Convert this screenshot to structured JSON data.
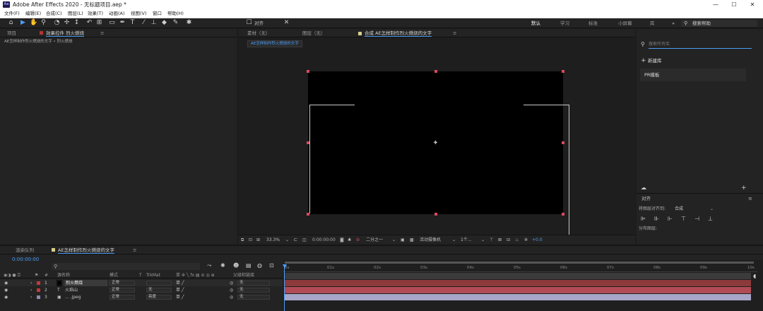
{
  "app": {
    "title": "Adobe After Effects 2020 - 无标题项目.aep *",
    "logo": "Ae",
    "window_controls": [
      "—",
      "☐",
      "✕"
    ]
  },
  "menu": [
    "文件(F)",
    "编辑(E)",
    "合成(C)",
    "图层(L)",
    "效果(T)",
    "动画(A)",
    "视图(V)",
    "窗口",
    "帮助(H)"
  ],
  "toolbar": {
    "align_label": "对齐",
    "workspaces": [
      "默认",
      "学习",
      "标准",
      "小屏幕",
      "库"
    ],
    "active_workspace": "默认",
    "overflow": "»",
    "help_search_placeholder": "搜索帮助"
  },
  "left_panel": {
    "tabs": [
      "项目",
      "效果控件 烈火燃烧"
    ],
    "breadcrumb": "AE怎样制作烈火燃烧的文字 • 烈火燃烧"
  },
  "comp_panel": {
    "tabs": [
      "素材（无）",
      "图层（无）",
      "合成 AE怎样制作烈火燃烧的文字"
    ],
    "comp_chip": "AE怎样制作烈火燃烧的文字"
  },
  "comp_footer": {
    "zoom": "33.3%",
    "timecode": "0:00:00:00",
    "resolution": "二分之一",
    "camera": "活动摄像机",
    "views": "1个...",
    "exposure": "+0.0"
  },
  "right_panel": {
    "search_placeholder": "搜索所有库",
    "new_library": "新建库",
    "library_item": "PR模板",
    "align_title": "对齐",
    "align_to_label": "将图层对齐到:",
    "align_to_value": "合成",
    "distribute_label": "分布图层:"
  },
  "timeline": {
    "tabs": [
      "渲染队列",
      "AE怎样制作烈火燃烧的文字"
    ],
    "timecode": "0:00:00:00",
    "search_placeholder": "",
    "columns": {
      "num": "#",
      "name": "源名称",
      "mode": "模式",
      "t": "T",
      "trkmat": "TrkMat",
      "switches": "单 ✲ ╲ fx ▤ ⊘ ◎ ⊕",
      "parent": "父级和链接"
    },
    "ruler": [
      "0s",
      "01s",
      "02s",
      "03s",
      "04s",
      "05s",
      "06s",
      "07s",
      "08s",
      "09s",
      "10s"
    ],
    "layers": [
      {
        "num": "1",
        "type_icon": "■",
        "name": "烈火燃烧",
        "mode": "正常",
        "trkmat": "",
        "parent": "无",
        "color": "#c23a3a",
        "bar_color": "#8d3a3c"
      },
      {
        "num": "2",
        "type_icon": "T",
        "name": "火焰山",
        "mode": "正常",
        "trkmat": "无",
        "parent": "无",
        "color": "#c23a3a",
        "bar_color": "#b24b55"
      },
      {
        "num": "3",
        "type_icon": "▣",
        "name": "... .jpeg",
        "mode": "正常",
        "trkmat": "亮度",
        "parent": "无",
        "color": "#8a8ab5",
        "bar_color": "#a7a6c8"
      }
    ]
  }
}
